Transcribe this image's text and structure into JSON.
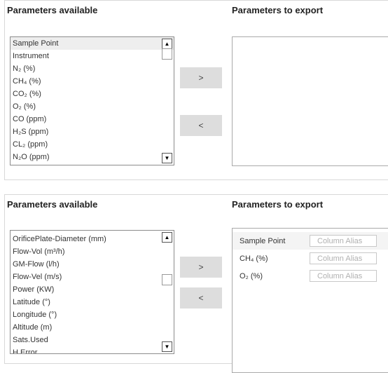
{
  "top": {
    "available_title": "Parameters available",
    "export_title": "Parameters to export",
    "items": [
      {
        "label": "Sample Point",
        "selected": true
      },
      {
        "label": "Instrument"
      },
      {
        "label": "N₂ (%)"
      },
      {
        "label": "CH₄ (%)"
      },
      {
        "label": "CO₂ (%)"
      },
      {
        "label": "O₂ (%)"
      },
      {
        "label": "CO (ppm)"
      },
      {
        "label": "H₂S (ppm)"
      },
      {
        "label": "CL₂ (ppm)"
      },
      {
        "label": "N₂O (ppm)"
      }
    ],
    "add_label": ">",
    "remove_label": "<"
  },
  "bottom": {
    "available_title": "Parameters available",
    "export_title": "Parameters to export",
    "items": [
      {
        "label": "OrificePlate-Diameter (mm)"
      },
      {
        "label": "Flow-Vol (m³/h)"
      },
      {
        "label": "GM-Flow (l/h)"
      },
      {
        "label": "Flow-Vel (m/s)"
      },
      {
        "label": "Power (KW)"
      },
      {
        "label": "Latitude (°)"
      },
      {
        "label": "Longitude (°)"
      },
      {
        "label": "Altitude (m)"
      },
      {
        "label": "Sats.Used"
      },
      {
        "label": "H.Error"
      }
    ],
    "add_label": ">",
    "remove_label": "<",
    "export_items": [
      {
        "label": "Sample Point",
        "alias_placeholder": "Column Alias",
        "alias_value": ""
      },
      {
        "label": "CH₄ (%)",
        "alias_placeholder": "Column Alias",
        "alias_value": ""
      },
      {
        "label": "O₂ (%)",
        "alias_placeholder": "Column Alias",
        "alias_value": ""
      }
    ]
  },
  "icons": {
    "scroll_up": "triangle-up-icon",
    "scroll_down": "triangle-down-icon"
  }
}
